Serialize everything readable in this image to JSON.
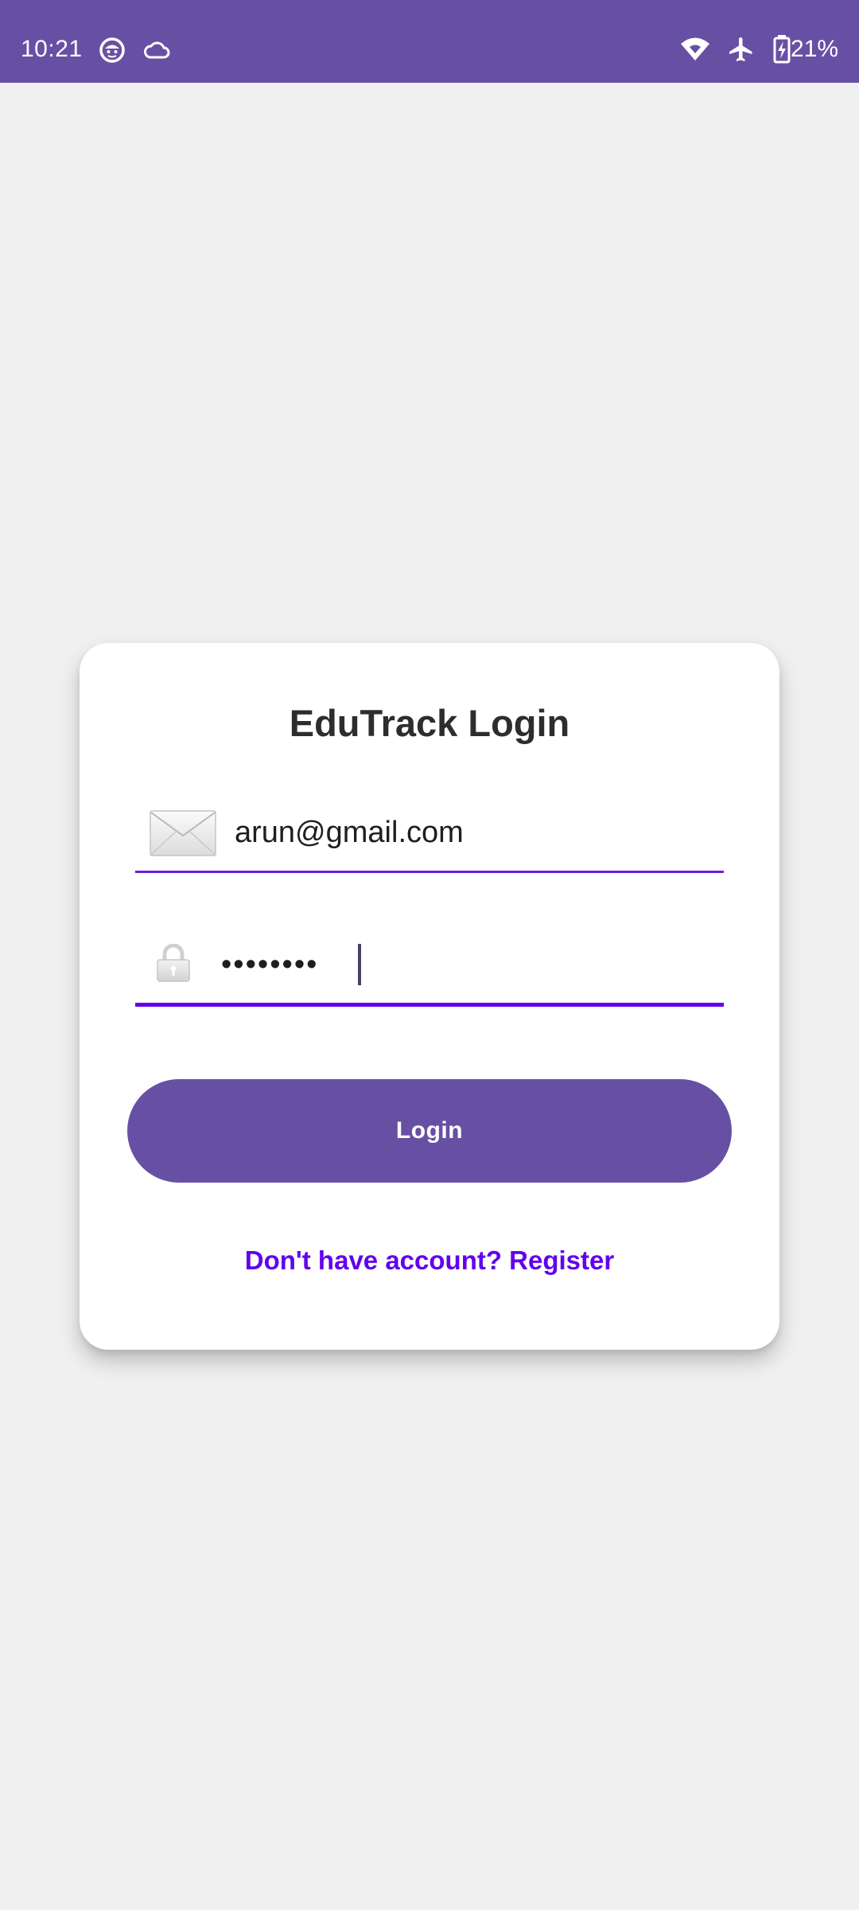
{
  "status_bar": {
    "time": "10:21",
    "battery_percent": "21%",
    "icons": [
      "face-notification-icon",
      "cloud-icon",
      "wifi-icon",
      "airplane-mode-icon",
      "battery-charging-icon"
    ],
    "background_color": "#6750a4"
  },
  "login_card": {
    "title": "EduTrack Login",
    "email_field": {
      "icon": "envelope-icon",
      "value": "arun@gmail.com"
    },
    "password_field": {
      "icon": "lock-icon",
      "value": "••••••••",
      "focused": true
    },
    "login_button_label": "Login",
    "register_link_text": "Don't have account? Register"
  },
  "colors": {
    "primary": "#6750a4",
    "accent": "#6200ee",
    "page_background": "#f0f0f0",
    "card_background": "#ffffff"
  }
}
